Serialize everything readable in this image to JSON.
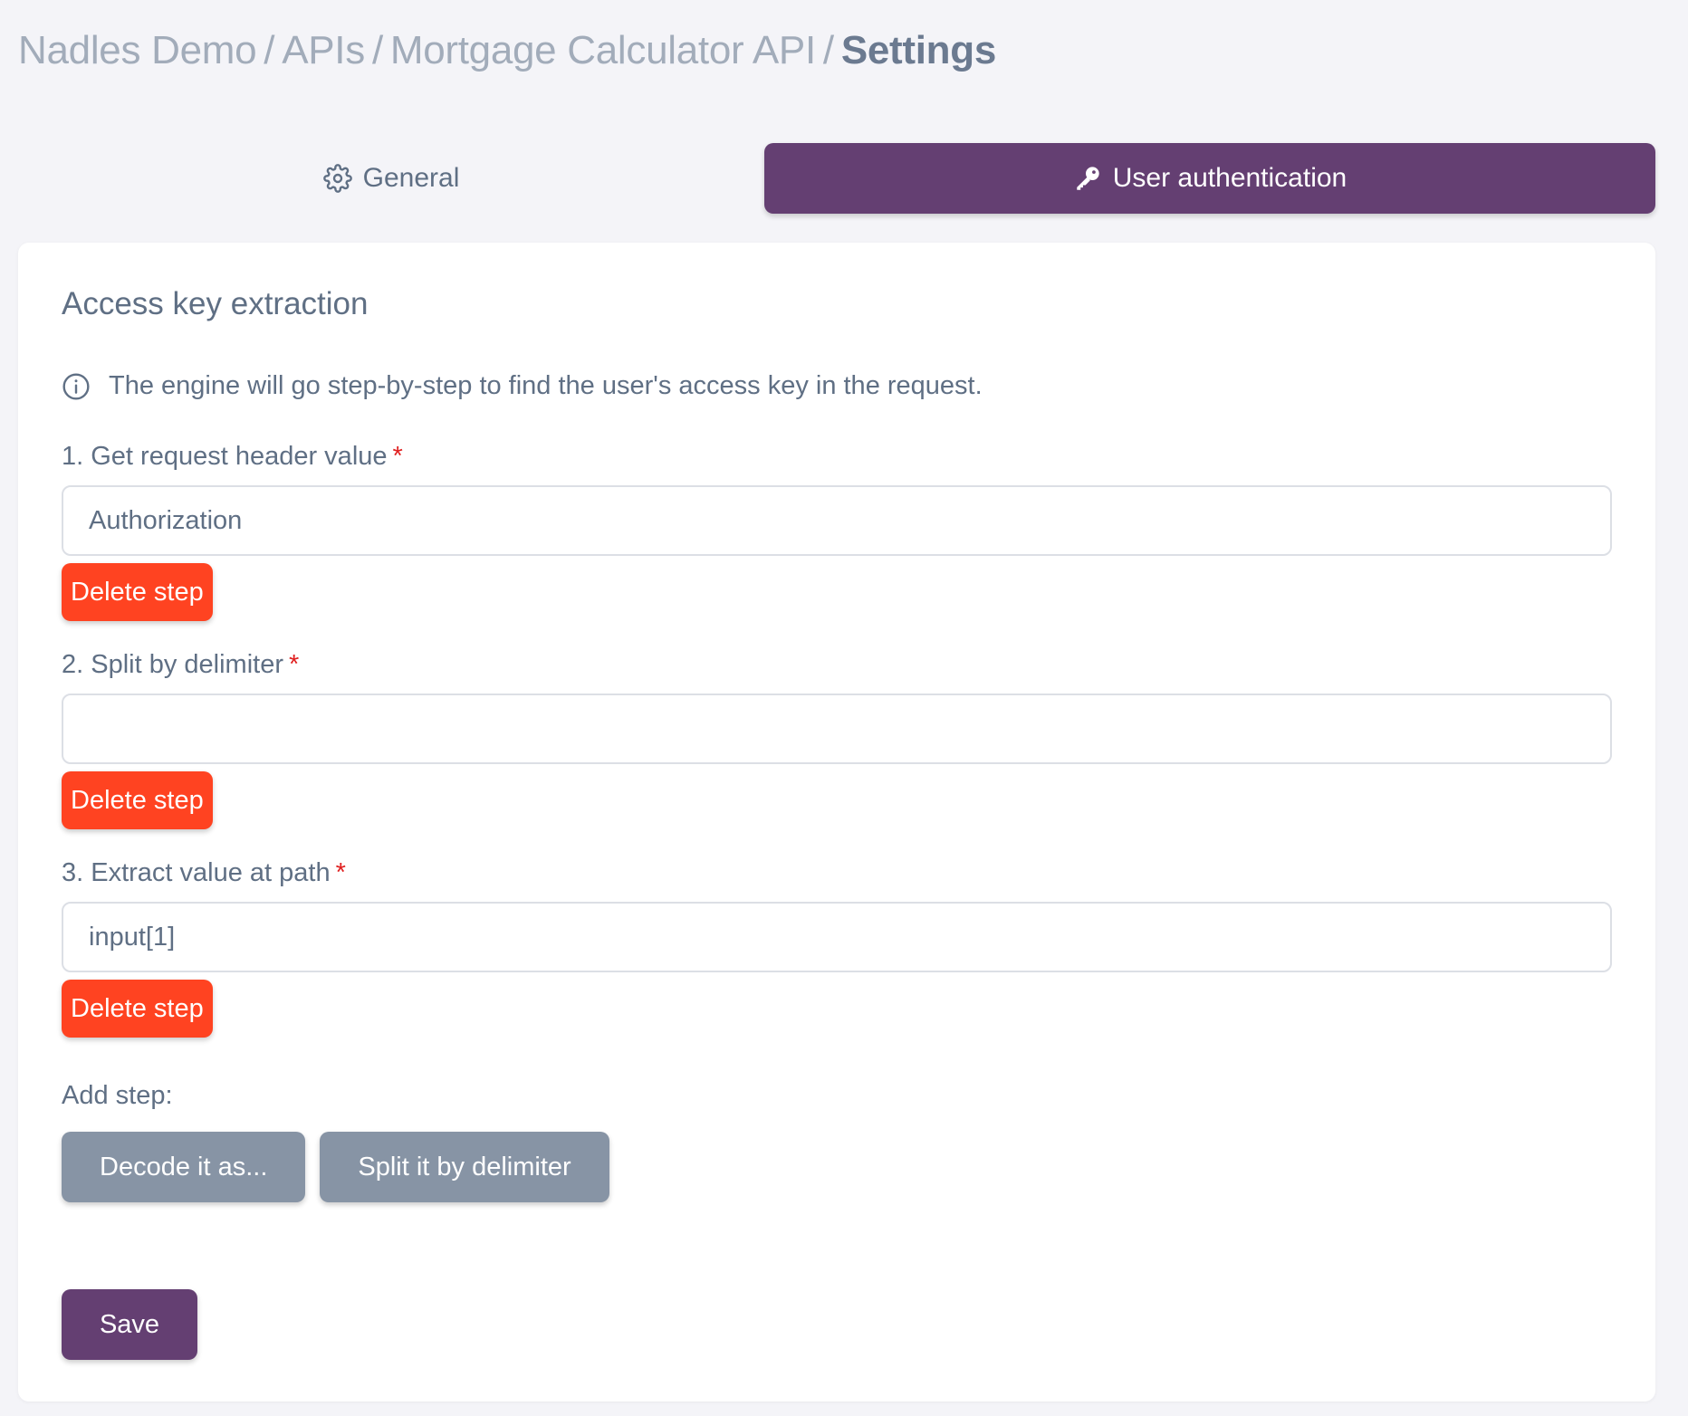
{
  "breadcrumb": {
    "items": [
      "Nadles Demo",
      "APIs",
      "Mortgage Calculator API"
    ],
    "separator": "/",
    "current": "Settings"
  },
  "tabs": {
    "general": {
      "label": "General",
      "icon": "gear-icon"
    },
    "auth": {
      "label": "User authentication",
      "icon": "key-icon",
      "active": true
    }
  },
  "section": {
    "title": "Access key extraction",
    "info": "The engine will go step-by-step to find the user's access key in the request.",
    "info_icon": "info-icon"
  },
  "steps": [
    {
      "label": "1. Get request header value",
      "required": "*",
      "value": "Authorization",
      "placeholder": "",
      "delete_label": "Delete step"
    },
    {
      "label": "2. Split by delimiter",
      "required": "*",
      "value": "",
      "placeholder": "",
      "delete_label": "Delete step"
    },
    {
      "label": "3. Extract value at path",
      "required": "*",
      "value": "input[1]",
      "placeholder": "",
      "delete_label": "Delete step"
    }
  ],
  "add_step": {
    "label": "Add step:",
    "buttons": [
      "Decode it as...",
      "Split it by delimiter"
    ]
  },
  "save_label": "Save",
  "colors": {
    "brand": "#643f72",
    "danger": "#ff4321",
    "secondary": "#8794a5",
    "background": "#f4f4f8",
    "text": "#5f6f84"
  }
}
